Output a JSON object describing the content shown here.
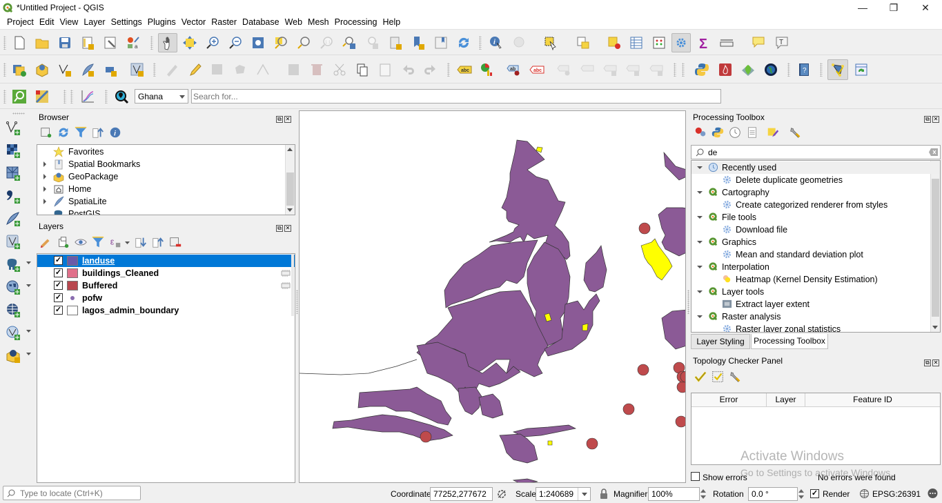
{
  "window": {
    "title": "*Untitled Project - QGIS",
    "minimize": "—",
    "restore": "❐",
    "close": "✕"
  },
  "menu": [
    "Project",
    "Edit",
    "View",
    "Layer",
    "Settings",
    "Plugins",
    "Vector",
    "Raster",
    "Database",
    "Web",
    "Mesh",
    "Processing",
    "Help"
  ],
  "locator_toolbar": {
    "country_select": "Ghana",
    "search_placeholder": "Search for..."
  },
  "browser": {
    "title": "Browser",
    "items": [
      {
        "label": "Favorites",
        "icon": "star-icon",
        "expandable": false
      },
      {
        "label": "Spatial Bookmarks",
        "icon": "bookmark-icon",
        "expandable": true
      },
      {
        "label": "GeoPackage",
        "icon": "geopackage-icon",
        "expandable": true
      },
      {
        "label": "Home",
        "icon": "home-folder-icon",
        "expandable": true
      },
      {
        "label": "SpatiaLite",
        "icon": "feather-icon",
        "expandable": true
      },
      {
        "label": "PostGIS",
        "icon": "elephant-icon",
        "expandable": true
      }
    ]
  },
  "layers": {
    "title": "Layers",
    "items": [
      {
        "label": "landuse",
        "checked": true,
        "swatch": "#6a5aa8",
        "selected": true,
        "type": "polygon"
      },
      {
        "label": "buildings_Cleaned",
        "checked": true,
        "swatch": "#e0708a",
        "selected": false,
        "type": "polygon",
        "memory": true
      },
      {
        "label": "Buffered",
        "checked": true,
        "swatch": "#b8474e",
        "selected": false,
        "type": "polygon",
        "memory": true
      },
      {
        "label": "pofw",
        "checked": true,
        "swatch": "#8a6db0",
        "selected": false,
        "type": "point"
      },
      {
        "label": "lagos_admin_boundary",
        "checked": true,
        "swatch": "#ffffff",
        "selected": false,
        "type": "polygon"
      }
    ]
  },
  "map": {
    "colors": {
      "landuse": "#8b5a96",
      "buildings": "#ffff00",
      "buffered": "#bf4a4c",
      "outline": "#333333"
    }
  },
  "processing": {
    "title": "Processing Toolbox",
    "search_value": "de",
    "groups": [
      {
        "label": "Recently used",
        "icon": "clock-icon",
        "items": [
          {
            "label": "Delete duplicate geometries",
            "icon": "gear-icon"
          }
        ]
      },
      {
        "label": "Cartography",
        "icon": "qgis-icon",
        "items": [
          {
            "label": "Create categorized renderer from styles",
            "icon": "gear-icon"
          }
        ]
      },
      {
        "label": "File tools",
        "icon": "qgis-icon",
        "items": [
          {
            "label": "Download file",
            "icon": "gear-icon"
          }
        ]
      },
      {
        "label": "Graphics",
        "icon": "qgis-icon",
        "items": [
          {
            "label": "Mean and standard deviation plot",
            "icon": "gear-icon"
          }
        ]
      },
      {
        "label": "Interpolation",
        "icon": "qgis-icon",
        "items": [
          {
            "label": "Heatmap (Kernel Density Estimation)",
            "icon": "heatmap-icon"
          }
        ]
      },
      {
        "label": "Layer tools",
        "icon": "qgis-icon",
        "items": [
          {
            "label": "Extract layer extent",
            "icon": "extent-icon"
          }
        ]
      },
      {
        "label": "Raster analysis",
        "icon": "qgis-icon",
        "items": [
          {
            "label": "Raster layer zonal statistics",
            "icon": "gear-icon"
          }
        ]
      }
    ],
    "tabs": [
      {
        "label": "Layer Styling",
        "active": false
      },
      {
        "label": "Processing Toolbox",
        "active": true
      }
    ]
  },
  "topology": {
    "title": "Topology Checker Panel",
    "columns": [
      "Error",
      "Layer",
      "Feature ID"
    ],
    "show_errors_label": "Show errors",
    "show_errors_checked": false,
    "status": "No errors were found"
  },
  "watermark": {
    "line1": "Activate Windows",
    "line2": "Go to Settings to activate Windows."
  },
  "statusbar": {
    "locate_placeholder": "Type to locate (Ctrl+K)",
    "coordinate_label": "Coordinate",
    "coordinate_value": "77252,277672",
    "scale_label": "Scale",
    "scale_value": "1:240689",
    "magnifier_label": "Magnifier",
    "magnifier_value": "100%",
    "rotation_label": "Rotation",
    "rotation_value": "0.0 °",
    "render_label": "Render",
    "render_checked": true,
    "crs": "EPSG:26391"
  }
}
